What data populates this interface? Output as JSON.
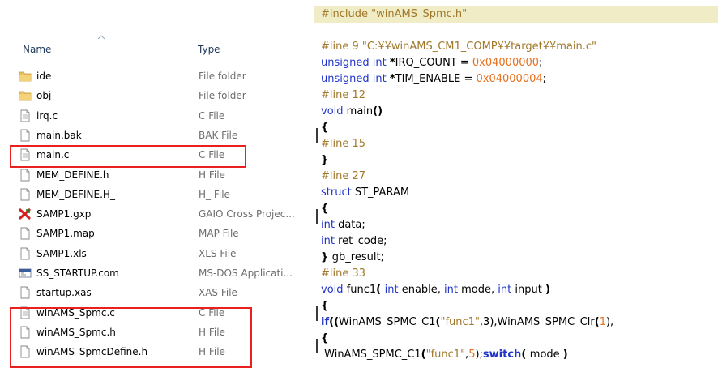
{
  "explorer": {
    "columns": {
      "name": "Name",
      "type": "Type"
    },
    "files": [
      {
        "name": "ide",
        "type": "File folder",
        "icon": "folder-icon"
      },
      {
        "name": "obj",
        "type": "File folder",
        "icon": "folder-icon"
      },
      {
        "name": "irq.c",
        "type": "C File",
        "icon": "c-file-icon"
      },
      {
        "name": "main.bak",
        "type": "BAK File",
        "icon": "file-icon"
      },
      {
        "name": "main.c",
        "type": "C File",
        "icon": "c-file-icon"
      },
      {
        "name": "MEM_DEFINE.h",
        "type": "H File",
        "icon": "file-icon"
      },
      {
        "name": "MEM_DEFINE.H_",
        "type": "H_ File",
        "icon": "file-icon"
      },
      {
        "name": "SAMP1.gxp",
        "type": "GAIO Cross Projec...",
        "icon": "gaio-project-icon"
      },
      {
        "name": "SAMP1.map",
        "type": "MAP File",
        "icon": "file-icon"
      },
      {
        "name": "SAMP1.xls",
        "type": "XLS File",
        "icon": "file-icon"
      },
      {
        "name": "SS_STARTUP.com",
        "type": "MS-DOS Applicati...",
        "icon": "dos-app-icon"
      },
      {
        "name": "startup.xas",
        "type": "XAS File",
        "icon": "file-icon"
      },
      {
        "name": "winAMS_Spmc.c",
        "type": "C File",
        "icon": "c-file-icon"
      },
      {
        "name": "winAMS_Spmc.h",
        "type": "H File",
        "icon": "file-icon"
      },
      {
        "name": "winAMS_SpmcDefine.h",
        "type": "H File",
        "icon": "file-icon"
      }
    ],
    "highlight_color": "#e8201f"
  },
  "code": {
    "lines": [
      [
        {
          "t": "#include ",
          "c": "c-dir"
        },
        {
          "t": "\"winAMS_Spmc.h\"",
          "c": "c-str"
        }
      ],
      [],
      [
        {
          "t": "#line 9 ",
          "c": "c-dir"
        },
        {
          "t": "\"C:¥¥winAMS_CM1_COMP¥¥target¥¥main.c\"",
          "c": "c-str"
        }
      ],
      [
        {
          "t": "unsigned int ",
          "c": "c-key"
        },
        {
          "t": "*",
          "c": "c-txt c-bold"
        },
        {
          "t": "IRQ_COUNT = ",
          "c": "c-txt"
        },
        {
          "t": "0x04000000",
          "c": "c-num"
        },
        {
          "t": ";",
          "c": "c-txt"
        }
      ],
      [
        {
          "t": "unsigned int ",
          "c": "c-key"
        },
        {
          "t": "*",
          "c": "c-txt c-bold"
        },
        {
          "t": "TIM_ENABLE = ",
          "c": "c-txt"
        },
        {
          "t": "0x04000004",
          "c": "c-num"
        },
        {
          "t": ";",
          "c": "c-txt"
        }
      ],
      [
        {
          "t": "#line 12",
          "c": "c-dir"
        }
      ],
      [
        {
          "t": "void ",
          "c": "c-key"
        },
        {
          "t": "main",
          "c": "c-txt"
        },
        {
          "t": "()",
          "c": "c-paren"
        }
      ],
      [
        {
          "t": "{",
          "c": "c-txt c-bold"
        }
      ],
      [
        {
          "t": "#line 15",
          "c": "c-dir"
        }
      ],
      [
        {
          "t": "}",
          "c": "c-txt c-bold"
        }
      ],
      [
        {
          "t": "#line 27",
          "c": "c-dir"
        }
      ],
      [
        {
          "t": "struct ",
          "c": "c-key"
        },
        {
          "t": "ST_PARAM",
          "c": "c-txt"
        }
      ],
      [
        {
          "t": "{",
          "c": "c-txt c-bold"
        }
      ],
      [
        {
          "t": "int ",
          "c": "c-key"
        },
        {
          "t": "data;",
          "c": "c-txt"
        }
      ],
      [
        {
          "t": "int ",
          "c": "c-key"
        },
        {
          "t": "ret_code;",
          "c": "c-txt"
        }
      ],
      [
        {
          "t": "} ",
          "c": "c-txt c-bold"
        },
        {
          "t": "gb_result;",
          "c": "c-txt"
        }
      ],
      [
        {
          "t": "#line 33",
          "c": "c-dir"
        }
      ],
      [
        {
          "t": "void ",
          "c": "c-key"
        },
        {
          "t": "func1",
          "c": "c-txt"
        },
        {
          "t": "( ",
          "c": "c-paren"
        },
        {
          "t": "int ",
          "c": "c-key"
        },
        {
          "t": "enable, ",
          "c": "c-txt"
        },
        {
          "t": "int ",
          "c": "c-key"
        },
        {
          "t": "mode, ",
          "c": "c-txt"
        },
        {
          "t": "int ",
          "c": "c-key"
        },
        {
          "t": "input ",
          "c": "c-txt"
        },
        {
          "t": ")",
          "c": "c-paren"
        }
      ],
      [
        {
          "t": "{",
          "c": "c-txt c-bold"
        }
      ],
      [
        {
          "t": "if",
          "c": "c-key c-bold"
        },
        {
          "t": "((",
          "c": "c-paren"
        },
        {
          "t": "WinAMS_SPMC_C1",
          "c": "c-txt"
        },
        {
          "t": "(",
          "c": "c-paren"
        },
        {
          "t": "\"func1\"",
          "c": "c-str"
        },
        {
          "t": ",3),",
          "c": "c-txt"
        },
        {
          "t": "WinAMS_SPMC_Clr",
          "c": "c-txt"
        },
        {
          "t": "(",
          "c": "c-paren"
        },
        {
          "t": "1",
          "c": "c-num"
        },
        {
          "t": "),",
          "c": "c-txt"
        }
      ],
      [
        {
          "t": "{",
          "c": "c-txt c-bold"
        }
      ],
      [
        {
          "t": " WinAMS_SPMC_C1",
          "c": "c-txt"
        },
        {
          "t": "(",
          "c": "c-paren"
        },
        {
          "t": "\"func1\"",
          "c": "c-str"
        },
        {
          "t": ",",
          "c": "c-txt"
        },
        {
          "t": "5",
          "c": "c-num"
        },
        {
          "t": ");",
          "c": "c-txt"
        },
        {
          "t": "switch",
          "c": "c-key c-bold"
        },
        {
          "t": "( ",
          "c": "c-paren"
        },
        {
          "t": "mode ",
          "c": "c-txt"
        },
        {
          "t": ")",
          "c": "c-paren"
        }
      ]
    ],
    "highlight_line_color": "#f0ecc6"
  }
}
